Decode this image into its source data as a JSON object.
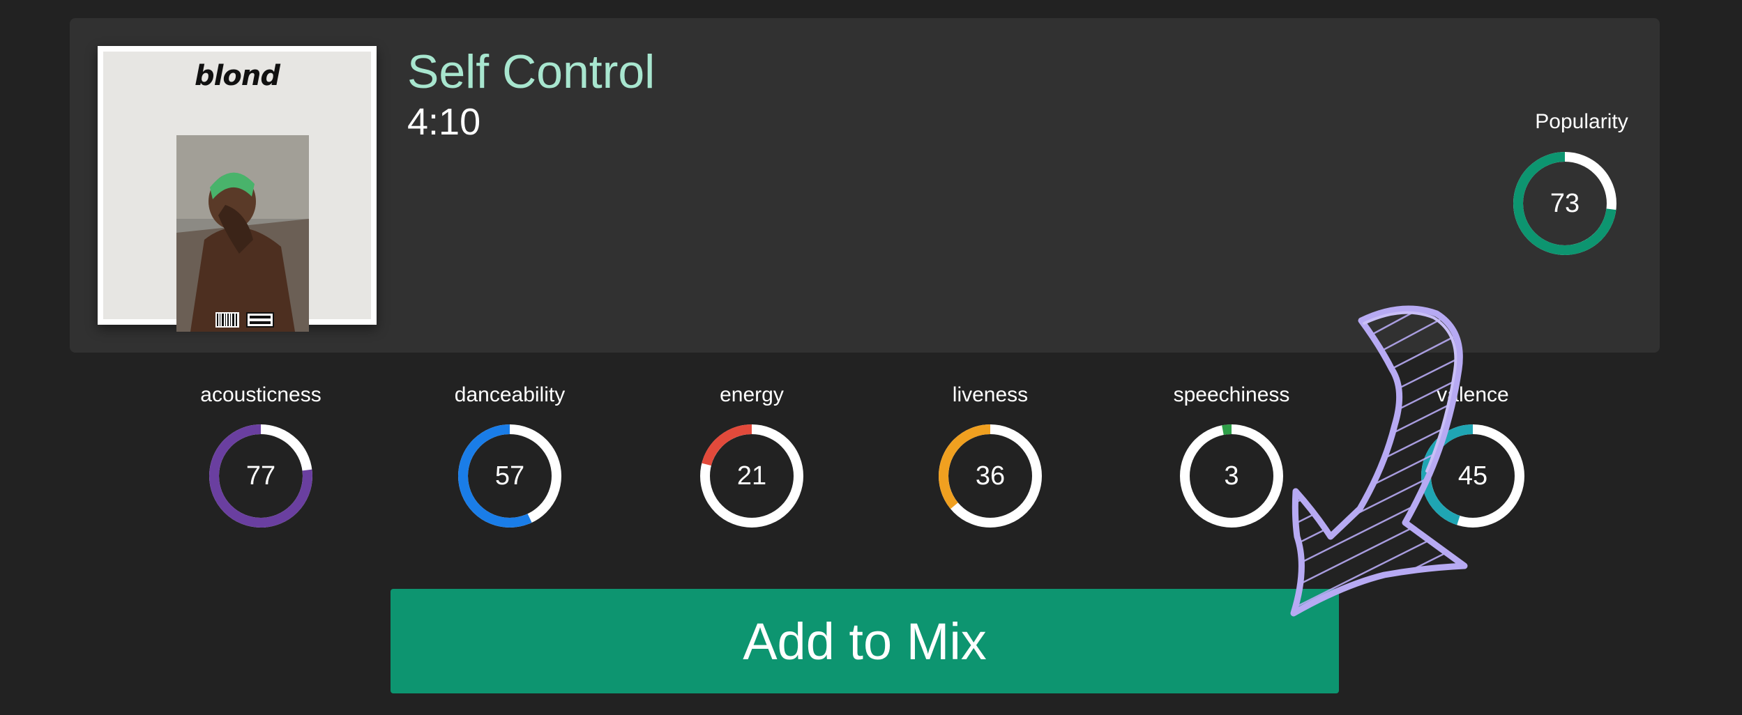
{
  "track": {
    "title": "Self Control",
    "duration": "4:10",
    "album_cover": {
      "brand_text": "blond"
    }
  },
  "popularity": {
    "label": "Popularity",
    "value": 73,
    "color": "#0d9570"
  },
  "features": [
    {
      "label": "acousticness",
      "value": 77,
      "color": "#6a3fa0"
    },
    {
      "label": "danceability",
      "value": 57,
      "color": "#1a7de8"
    },
    {
      "label": "energy",
      "value": 21,
      "color": "#e24a3b"
    },
    {
      "label": "liveness",
      "value": 36,
      "color": "#f0a020"
    },
    {
      "label": "speechiness",
      "value": 3,
      "color": "#2e9e48"
    },
    {
      "label": "valence",
      "value": 45,
      "color": "#1fa5b3"
    }
  ],
  "actions": {
    "add_to_mix_label": "Add to Mix"
  },
  "annotation": {
    "icon": "hand-drawn-arrow-icon",
    "color": "#b7aaf3"
  }
}
